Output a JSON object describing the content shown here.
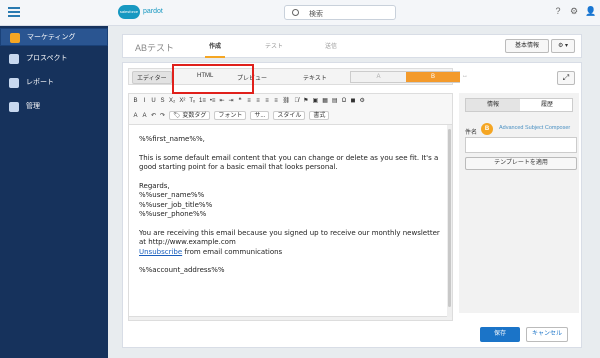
{
  "topbar": {
    "logo_badge": "salesforce",
    "logo_text": "pardot",
    "search_placeholder": "検索",
    "help": "?",
    "settings": "⚙",
    "user": "👤"
  },
  "sidebar": {
    "items": [
      {
        "label": "マーケティング"
      },
      {
        "label": "プロスペクト"
      },
      {
        "label": "レポート"
      },
      {
        "label": "管理"
      }
    ]
  },
  "header": {
    "title": "ABテスト",
    "tabs": [
      {
        "label": "作成"
      },
      {
        "label": "テスト"
      },
      {
        "label": "送信"
      }
    ],
    "basic_info": "基本情報",
    "gear": "⚙ ▾"
  },
  "editor": {
    "modes": [
      {
        "label": "エディター"
      },
      {
        "label": "HTML"
      },
      {
        "label": "プレビュー"
      },
      {
        "label": "テキスト"
      }
    ],
    "ab": {
      "a": "A",
      "b": "B"
    },
    "arrow": "↔",
    "expand": "⤢",
    "toolbar_row1": [
      "B",
      "I",
      "U",
      "S",
      "X₂",
      "X²",
      "Tₓ",
      "1≡",
      "•≡",
      "⇤",
      "⇥",
      "❝",
      "≡",
      "≡",
      "≡",
      "≡",
      "⛓",
      "⛓̸",
      "⚑",
      "▣",
      "▦",
      "▤",
      "Ω",
      "◼",
      "⚙"
    ],
    "toolbar_row2": [
      "A",
      "A",
      "↶",
      "↷",
      "🏷 変数タグ",
      "フォント",
      "サ...",
      "スタイル",
      "書式"
    ],
    "content": {
      "line1": "%%first_name%%,",
      "para1": "This is some default email content that you can change or delete as you see fit. It's a good starting point for a basic email that looks personal.",
      "regards": "Regards,",
      "sig1": "%%user_name%%",
      "sig2": "%%user_job_title%%",
      "sig3": "%%user_phone%%",
      "para2": "You are receiving this email because you signed up to receive our monthly newsletter at http://www.example.com",
      "unsub_link": "Unsubscribe",
      "unsub_rest": " from email communications",
      "address": "%%account_address%%"
    }
  },
  "right_panel": {
    "tabs": [
      {
        "label": "情報"
      },
      {
        "label": "履歴"
      }
    ],
    "subject_label": "件名",
    "badge": "B",
    "advanced": "Advanced Subject Composer",
    "template_button": "テンプレートを適用"
  },
  "footer": {
    "save": "保存",
    "cancel": "キャンセル"
  }
}
